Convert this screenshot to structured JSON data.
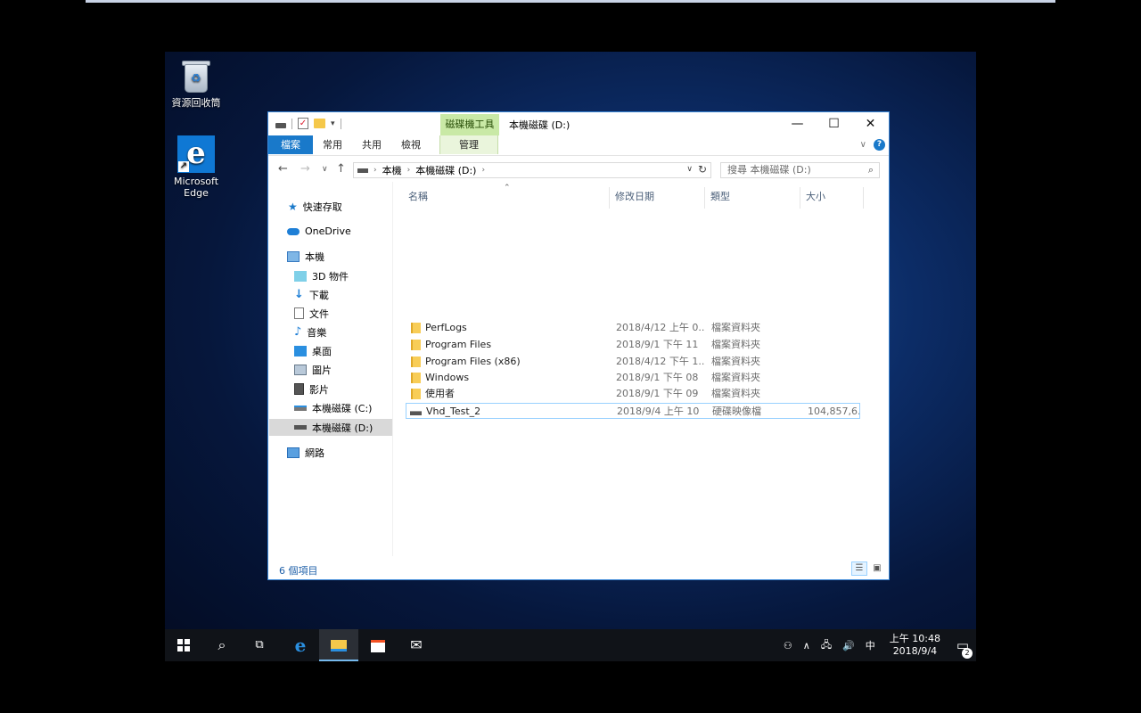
{
  "desktop": {
    "icons": [
      {
        "label": "資源回收筒",
        "icon": "recycle-bin-icon"
      },
      {
        "label": "Microsoft Edge",
        "icon": "edge-icon"
      }
    ]
  },
  "window": {
    "title": "本機磁碟 (D:)",
    "context_tab_header": "磁碟機工具",
    "ribbon_tabs": [
      "檔案",
      "常用",
      "共用",
      "檢視",
      "管理"
    ],
    "buttons": {
      "minimize": "—",
      "maximize": "☐",
      "close": "✕"
    }
  },
  "address_bar": {
    "crumbs": [
      "本機",
      "本機磁碟 (D:)"
    ],
    "refresh": "↻"
  },
  "search": {
    "placeholder": "搜尋 本機磁碟 (D:)"
  },
  "nav_pane": {
    "items": [
      {
        "label": "快速存取",
        "icon": "star-icon"
      },
      {
        "label": "OneDrive",
        "icon": "cloud-icon"
      },
      {
        "label": "本機",
        "icon": "computer-icon"
      },
      {
        "label": "3D 物件",
        "icon": "cube-icon"
      },
      {
        "label": "下載",
        "icon": "download-icon"
      },
      {
        "label": "文件",
        "icon": "document-icon"
      },
      {
        "label": "音樂",
        "icon": "music-icon"
      },
      {
        "label": "桌面",
        "icon": "desktop-icon"
      },
      {
        "label": "圖片",
        "icon": "pictures-icon"
      },
      {
        "label": "影片",
        "icon": "video-icon"
      },
      {
        "label": "本機磁碟 (C:)",
        "icon": "drive-c-icon"
      },
      {
        "label": "本機磁碟 (D:)",
        "icon": "drive-d-icon"
      },
      {
        "label": "網路",
        "icon": "network-icon"
      }
    ]
  },
  "file_list": {
    "columns": [
      "名稱",
      "修改日期",
      "類型",
      "大小"
    ],
    "rows": [
      {
        "name": "PerfLogs",
        "date": "2018/4/12 上午 0...",
        "type": "檔案資料夾",
        "size": ""
      },
      {
        "name": "Program Files",
        "date": "2018/9/1 下午 11",
        "type": "檔案資料夾",
        "size": ""
      },
      {
        "name": "Program Files (x86)",
        "date": "2018/4/12 下午 1...",
        "type": "檔案資料夾",
        "size": ""
      },
      {
        "name": "Windows",
        "date": "2018/9/1 下午 08",
        "type": "檔案資料夾",
        "size": ""
      },
      {
        "name": "使用者",
        "date": "2018/9/1 下午 09",
        "type": "檔案資料夾",
        "size": ""
      },
      {
        "name": "Vhd_Test_2",
        "date": "2018/9/4 上午 10",
        "type": "硬碟映像檔",
        "size": "104,857,6..."
      }
    ]
  },
  "status_bar": {
    "count": "6 個項目"
  },
  "taskbar": {
    "clock_time": "上午 10:48",
    "clock_date": "2018/9/4",
    "ime": "中",
    "notification_count": "2"
  }
}
